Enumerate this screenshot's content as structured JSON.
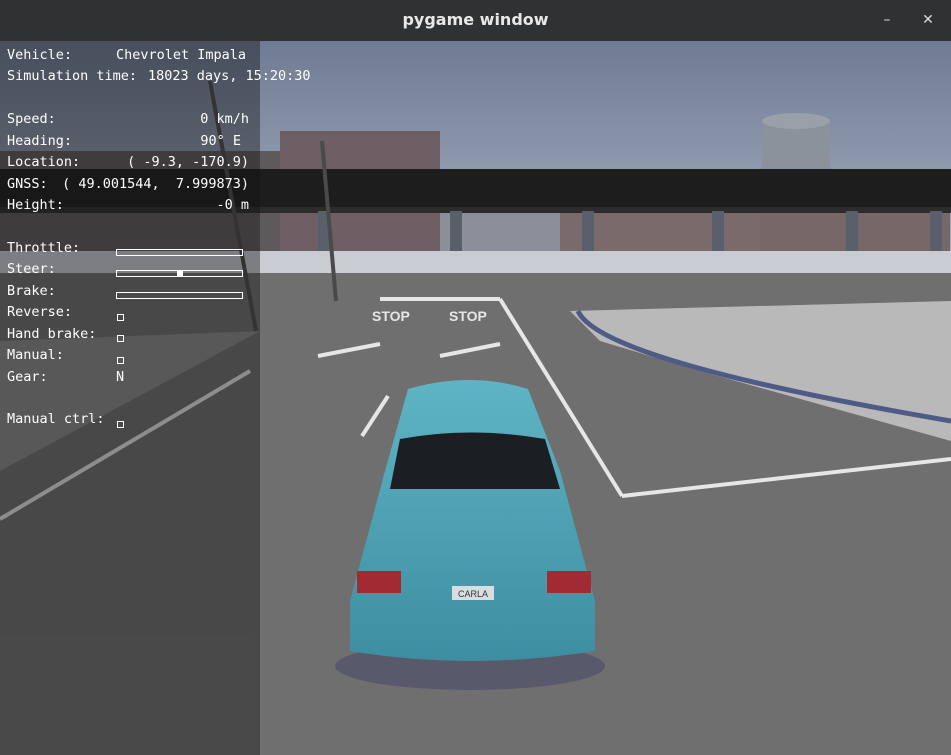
{
  "window": {
    "title": "pygame window",
    "minimize_icon": "minimize-icon",
    "close_icon": "close-icon"
  },
  "hud": {
    "vehicle": {
      "label": "Vehicle:",
      "value": "Chevrolet Impala"
    },
    "sim_time": {
      "label": "Simulation time:",
      "value": "18023 days, 15:20:30"
    },
    "speed": {
      "label": "Speed:",
      "value": "0 km/h"
    },
    "heading": {
      "label": "Heading:",
      "value": "90° E"
    },
    "location": {
      "label": "Location:",
      "value": "( -9.3, -170.9)"
    },
    "gnss": {
      "label": "GNSS:",
      "value": "( 49.001544,  7.999873)"
    },
    "height": {
      "label": "Height:",
      "value": "-0 m"
    },
    "throttle": {
      "label": "Throttle:",
      "value": 0.0
    },
    "steer": {
      "label": "Steer:",
      "value": 0.0
    },
    "brake": {
      "label": "Brake:",
      "value": 0.0
    },
    "reverse": {
      "label": "Reverse:",
      "checked": false
    },
    "hand_brake": {
      "label": "Hand brake:",
      "checked": false
    },
    "manual": {
      "label": "Manual:",
      "checked": false
    },
    "gear": {
      "label": "Gear:",
      "value": "N"
    },
    "manual_ctrl": {
      "label": "Manual ctrl:",
      "checked": false
    }
  },
  "scene": {
    "road_markings": [
      "STOP",
      "STOP"
    ],
    "license_plate": "CARLA",
    "colors": {
      "sky": "#8e98ab",
      "road": "#6f6f6f",
      "car": "#4ea3b3"
    }
  }
}
